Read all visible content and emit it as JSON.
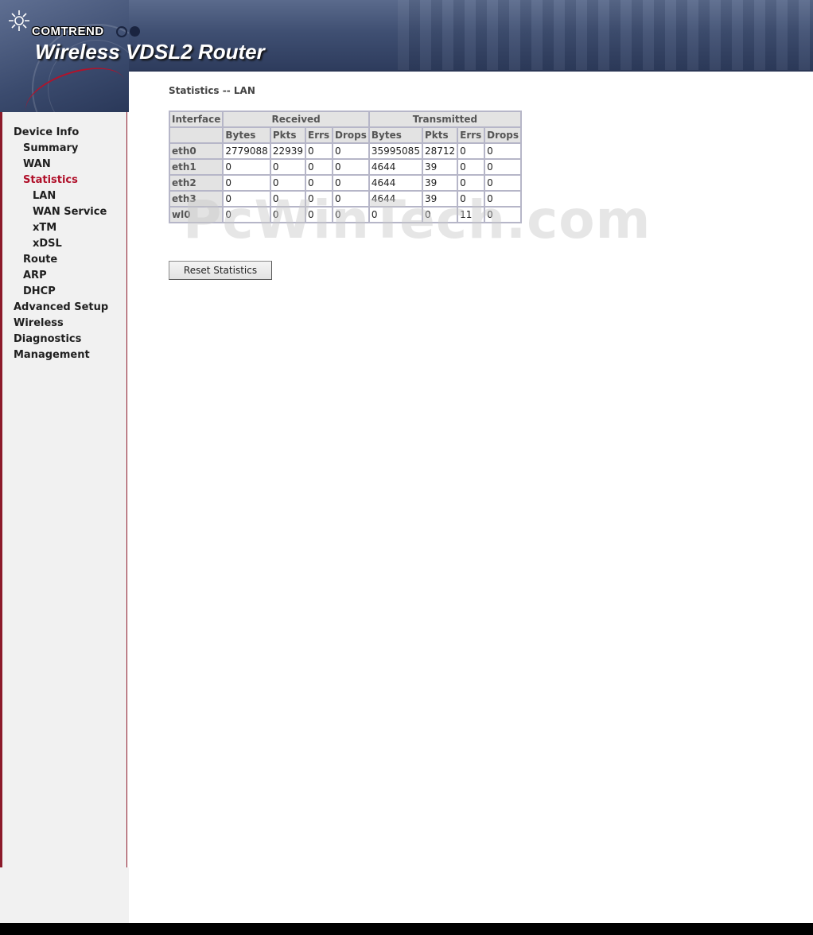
{
  "header": {
    "brand": "COMTREND",
    "product": "Wireless VDSL2 Router"
  },
  "sidebar": {
    "items": [
      {
        "label": "Device Info",
        "level": 0
      },
      {
        "label": "Summary",
        "level": 1
      },
      {
        "label": "WAN",
        "level": 1
      },
      {
        "label": "Statistics",
        "level": 1,
        "active": true
      },
      {
        "label": "LAN",
        "level": 2
      },
      {
        "label": "WAN Service",
        "level": 2
      },
      {
        "label": "xTM",
        "level": 2
      },
      {
        "label": "xDSL",
        "level": 2
      },
      {
        "label": "Route",
        "level": 1
      },
      {
        "label": "ARP",
        "level": 1
      },
      {
        "label": "DHCP",
        "level": 1
      },
      {
        "label": "Advanced Setup",
        "level": 0
      },
      {
        "label": "Wireless",
        "level": 0
      },
      {
        "label": "Diagnostics",
        "level": 0
      },
      {
        "label": "Management",
        "level": 0
      }
    ]
  },
  "main": {
    "title": "Statistics -- LAN",
    "table": {
      "interface_header": "Interface",
      "received_header": "Received",
      "transmitted_header": "Transmitted",
      "sub_headers": [
        "Bytes",
        "Pkts",
        "Errs",
        "Drops",
        "Bytes",
        "Pkts",
        "Errs",
        "Drops"
      ],
      "rows": [
        {
          "iface": "eth0",
          "values": [
            "2779088",
            "22939",
            "0",
            "0",
            "35995085",
            "28712",
            "0",
            "0"
          ]
        },
        {
          "iface": "eth1",
          "values": [
            "0",
            "0",
            "0",
            "0",
            "4644",
            "39",
            "0",
            "0"
          ]
        },
        {
          "iface": "eth2",
          "values": [
            "0",
            "0",
            "0",
            "0",
            "4644",
            "39",
            "0",
            "0"
          ]
        },
        {
          "iface": "eth3",
          "values": [
            "0",
            "0",
            "0",
            "0",
            "4644",
            "39",
            "0",
            "0"
          ]
        },
        {
          "iface": "wl0",
          "values": [
            "0",
            "0",
            "0",
            "0",
            "0",
            "0",
            "11",
            "0"
          ]
        }
      ]
    },
    "reset_button": "Reset Statistics",
    "watermark": "PcWinTech.com"
  },
  "colors": {
    "active_nav": "#b0102a",
    "sidebar_border": "#8c1a2a",
    "header_bg": "#3f4f72"
  }
}
